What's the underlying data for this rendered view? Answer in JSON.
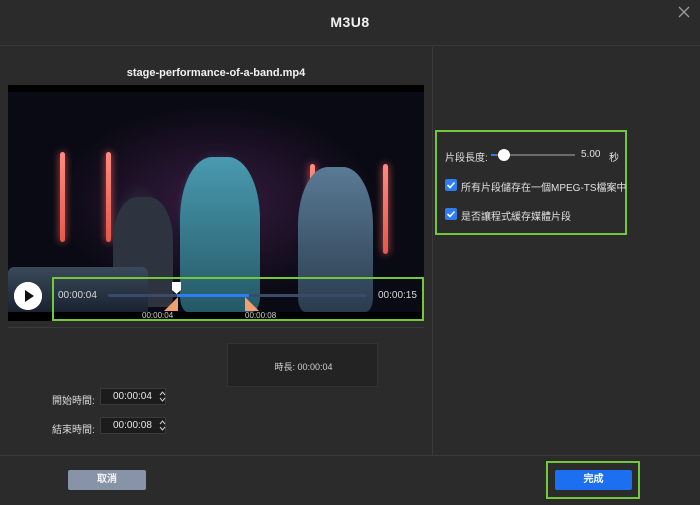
{
  "window": {
    "title": "M3U8"
  },
  "preview": {
    "filename": "stage-performance-of-a-band.mp4",
    "timeline": {
      "current_time": "00:00:04",
      "total_time": "00:00:15",
      "handle_start_label": "00:00:04",
      "handle_end_label": "00:00:08"
    }
  },
  "trim": {
    "start_label": "開始時間:",
    "start_value": "00:00:04",
    "end_label": "結束時間:",
    "end_value": "00:00:08",
    "duration_label": "時長: 00:00:04"
  },
  "settings": {
    "segment_length_label": "片段長度:",
    "segment_length_value": "5.00",
    "segment_length_unit": "秒",
    "segment_length_fraction": 0.05,
    "options": [
      {
        "label": "所有片段儲存在一個MPEG-TS檔案中",
        "checked": true
      },
      {
        "label": "是否讓程式緩存媒體片段",
        "checked": true
      }
    ]
  },
  "footer": {
    "cancel_label": "取消",
    "done_label": "完成"
  },
  "colors": {
    "accent": "#1b6ff0",
    "highlight": "#73c83a",
    "handle": "#f0a070",
    "background": "#2b2b2b"
  },
  "icons": {
    "close": "close-icon",
    "play": "play-icon",
    "spinner": "spinner-icon",
    "check": "check-icon"
  }
}
